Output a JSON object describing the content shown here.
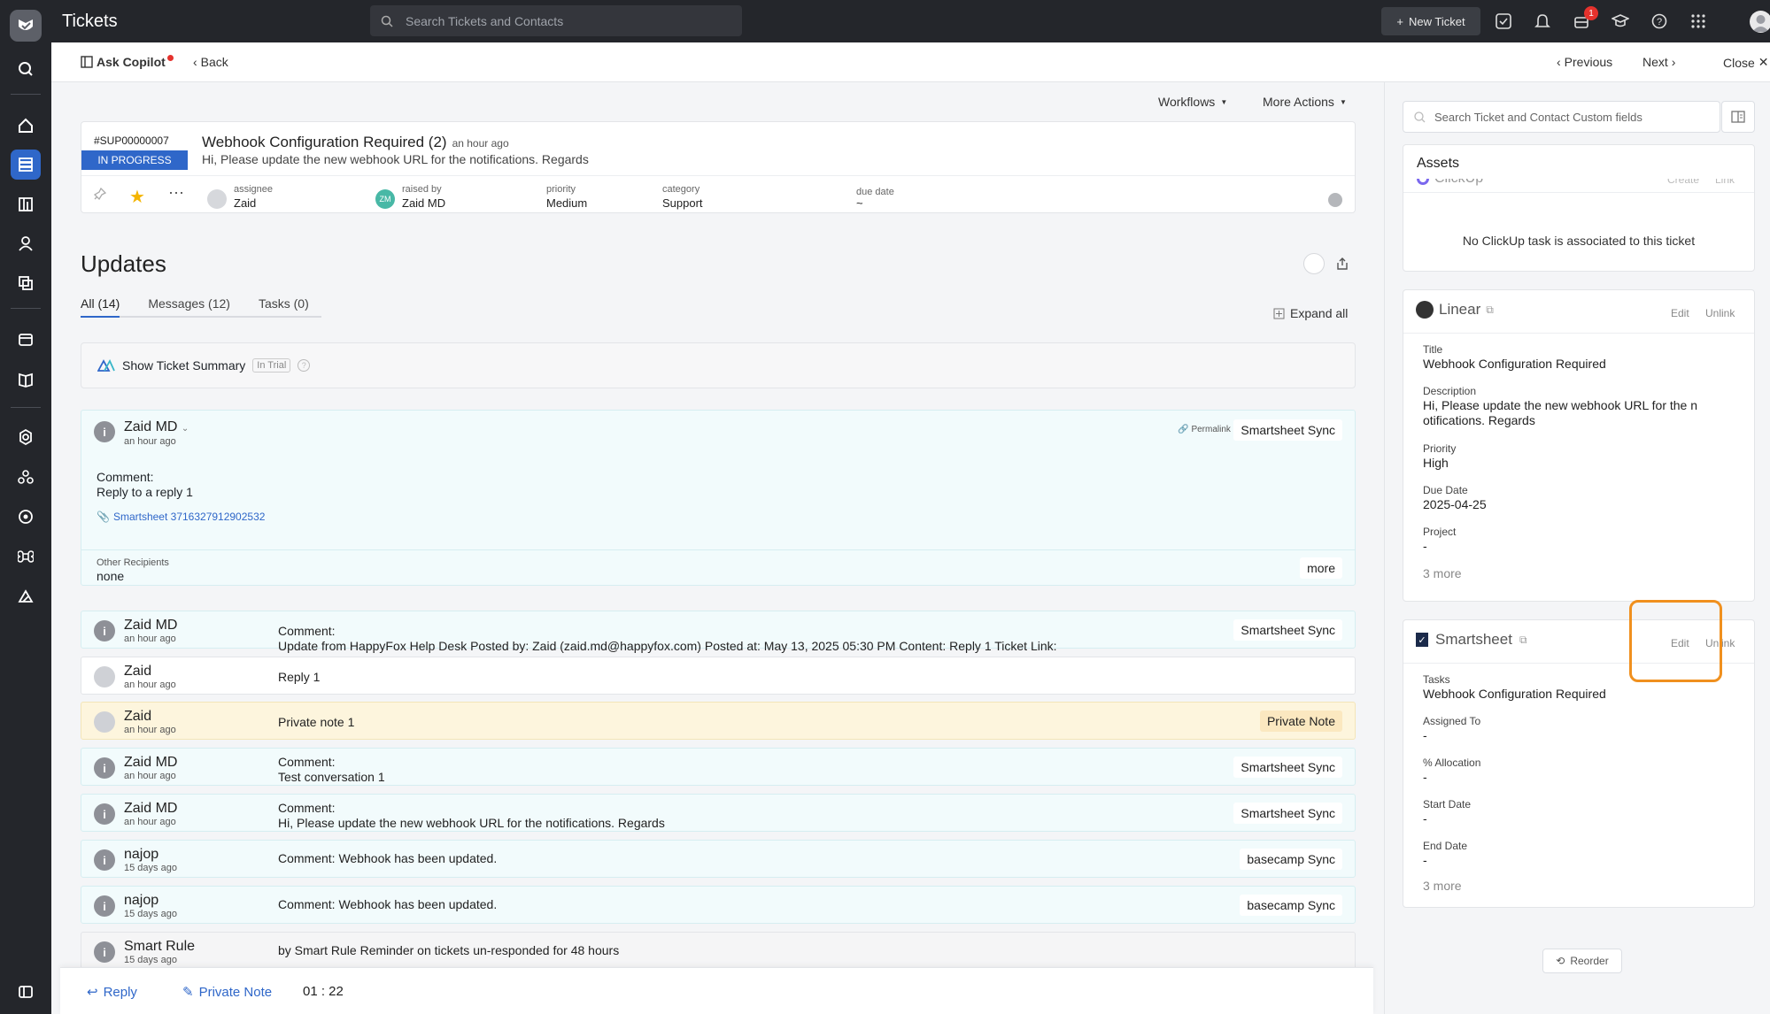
{
  "app": {
    "title": "Tickets"
  },
  "topbar": {
    "search_placeholder": "Search Tickets and Contacts",
    "new_ticket": "New Ticket",
    "notification_count": "1"
  },
  "subbar": {
    "ask_copilot": "Ask Copilot",
    "back": "Back",
    "previous": "Previous",
    "next": "Next",
    "close": "Close"
  },
  "actions": {
    "workflows": "Workflows",
    "more_actions": "More Actions"
  },
  "ticket": {
    "number": "#SUP00000007",
    "status": "IN PROGRESS",
    "subject": "Webhook Configuration Required (2)",
    "age": "an hour ago",
    "preview": "Hi, Please update the new webhook URL for the notifications. Regards",
    "assignee_label": "assignee",
    "assignee": "Zaid",
    "raised_by_label": "raised by",
    "raised_by": "Zaid MD",
    "raised_by_initials": "ZM",
    "priority_label": "priority",
    "priority": "Medium",
    "category_label": "category",
    "category": "Support",
    "due_date_label": "due date",
    "due_date": "~"
  },
  "updates": {
    "title": "Updates",
    "tabs": [
      {
        "label": "All (14)"
      },
      {
        "label": "Messages (12)"
      },
      {
        "label": "Tasks (0)"
      }
    ],
    "expand_all": "Expand all",
    "summary": {
      "label": "Show Ticket Summary",
      "badge": "In Trial"
    }
  },
  "expanded_message": {
    "author": "Zaid MD",
    "time": "an hour ago",
    "permalink": "Permalink",
    "source": "Smartsheet Sync",
    "comment_label": "Comment:",
    "comment": "Reply to a reply 1",
    "attachment": "Smartsheet 3716327912902532",
    "recipients_label": "Other Recipients",
    "recipients": "none",
    "more": "more"
  },
  "messages": [
    {
      "author": "Zaid MD",
      "time": "an hour ago",
      "line1": "Comment:",
      "line2": "Update from HappyFox Help Desk Posted by: Zaid (zaid.md@happyfox.com) Posted at: May 13, 2025 05:30 PM Content: Reply 1 Ticket Link:",
      "tag": "Smartsheet Sync"
    },
    {
      "author": "Zaid",
      "time": "an hour ago",
      "line1": "Reply 1"
    },
    {
      "author": "Zaid",
      "time": "an hour ago",
      "line1": "Private note 1",
      "tag": "Private Note"
    },
    {
      "author": "Zaid MD",
      "time": "an hour ago",
      "line1": "Comment:",
      "line2": "Test conversation 1",
      "tag": "Smartsheet Sync"
    },
    {
      "author": "Zaid MD",
      "time": "an hour ago",
      "line1": "Comment:",
      "line2": "Hi, Please update the new webhook URL for the notifications. Regards",
      "tag": "Smartsheet Sync"
    },
    {
      "author": "najop",
      "time": "15 days ago",
      "line1": "Comment: Webhook has been updated.",
      "tag": "basecamp Sync"
    },
    {
      "author": "najop",
      "time": "15 days ago",
      "line1": "Comment: Webhook has been updated.",
      "tag": "basecamp Sync"
    },
    {
      "author": "Smart Rule",
      "time": "15 days ago",
      "line1": "by Smart Rule Reminder on tickets un-responded for 48 hours"
    }
  ],
  "composer": {
    "reply": "Reply",
    "private_note": "Private Note",
    "timer": "01 : 22"
  },
  "right": {
    "search_placeholder": "Search Ticket and Contact Custom fields",
    "assets_title": "Assets",
    "clickup_name": "ClickUp",
    "clickup_edit": "Create",
    "clickup_unlink": "Link",
    "clickup_empty": "No ClickUp task is associated to this ticket",
    "linear": {
      "name": "Linear",
      "edit": "Edit",
      "unlink": "Unlink",
      "title_label": "Title",
      "title": "Webhook Configuration Required",
      "description_label": "Description",
      "description_1": "Hi, Please update the new webhook URL for the n",
      "description_2": "otifications. Regards",
      "priority_label": "Priority",
      "priority": "High",
      "due_label": "Due Date",
      "due": "2025-04-25",
      "project_label": "Project",
      "project": "-",
      "more": "3 more"
    },
    "smartsheet": {
      "name": "Smartsheet",
      "edit": "Edit",
      "unlink": "Unlink",
      "tasks_label": "Tasks",
      "tasks": "Webhook Configuration Required",
      "assigned_label": "Assigned To",
      "assigned": "-",
      "allocation_label": "% Allocation",
      "allocation": "-",
      "start_label": "Start Date",
      "start": "-",
      "end_label": "End Date",
      "end": "-",
      "more": "3 more"
    },
    "reorder": "Reorder",
    "highlight_color": "#f0901e"
  }
}
